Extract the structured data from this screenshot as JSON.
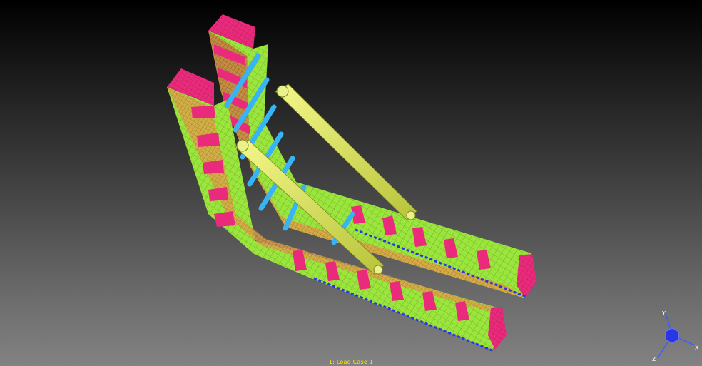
{
  "viewer": {
    "status_label": "1: Load Case 1",
    "background": {
      "top": "#000000",
      "bottom": "#828282"
    }
  },
  "triad": {
    "x_label": "X",
    "y_label": "Y",
    "z_label": "Z",
    "icon": "view-cube-icon"
  },
  "colors": {
    "shell_green": "#9be63c",
    "plate_magenta": "#ea2a7b",
    "stiffener_orange": "#d2842e",
    "strut_yellow": "#dde85c",
    "brace_cyan": "#37b4f5",
    "constraint_blue": "#2a35e6",
    "status_yellow": "#ffe800"
  }
}
